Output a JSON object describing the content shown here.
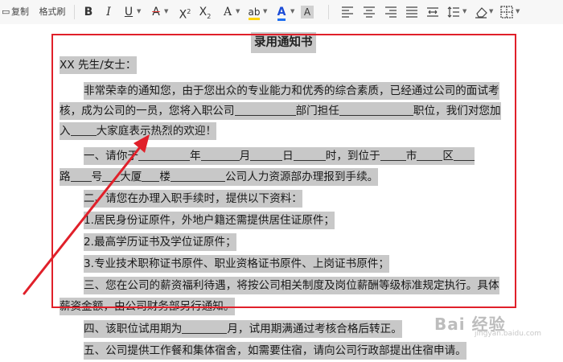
{
  "toolbar": {
    "copy": "复制",
    "format_painter": "格式刷",
    "bold": "B",
    "italic": "I",
    "underline": "U",
    "strike": "A",
    "superscript_base": "X",
    "superscript_mark": "2",
    "subscript_base": "X",
    "subscript_mark": "2",
    "text_effect": "A",
    "highlight": "ab",
    "font_color": "A",
    "char_shading": "A",
    "icons": [
      "align-left-icon",
      "align-center-icon",
      "align-right-icon",
      "justify-icon",
      "distributed-icon",
      "line-spacing-icon",
      "clear-format-icon",
      "borders-icon"
    ]
  },
  "document": {
    "title": "录用通知书",
    "salutation": "XX 先生/女士：",
    "para1": [
      "非常荣幸的通知您，由于您出众的专业能力和优秀的综合素质，已经通过公司的面试考",
      "核，成为公司的一员，您将入职公司",
      "部门担任",
      "职位，我们对您加",
      "入",
      "大家庭表示热烈的欢迎！"
    ],
    "item1": [
      "一、请你于",
      "年",
      "月",
      "日",
      "时，到位于",
      "市",
      "区"
    ],
    "item1_line2": [
      "路",
      "号",
      "大厦",
      "楼",
      "公司人力资源部办理报到手续。"
    ],
    "item2": "二、请您在办理入职手续时，提供以下资料：",
    "list": [
      "1.居民身份证原件，外地户籍还需提供居住证原件；",
      "2.最高学历证书及学位证原件；",
      "3.专业技术职称证书原件、职业资格证书原件、上岗证书原件；"
    ],
    "item3_line1": "三、您在公司的薪资福利待遇，将按公司相关制度及岗位薪酬等级标准规定执行。具体",
    "item3_line2": "薪资金额，由公司财务部另行通知。",
    "item4": [
      "四、该职位试用期为",
      "月，试用期满通过考核合格后转正。"
    ],
    "item5": "五、公司提供工作餐和集体宿舍，如需要住宿，请向公司行政部提出住宿申请。"
  },
  "watermark": {
    "brand": "Bai",
    "mark": "经验",
    "sub": "jingyan.baidu.com"
  },
  "colors": {
    "annotation": "#e0202a",
    "selection": "#c8c8c8"
  }
}
